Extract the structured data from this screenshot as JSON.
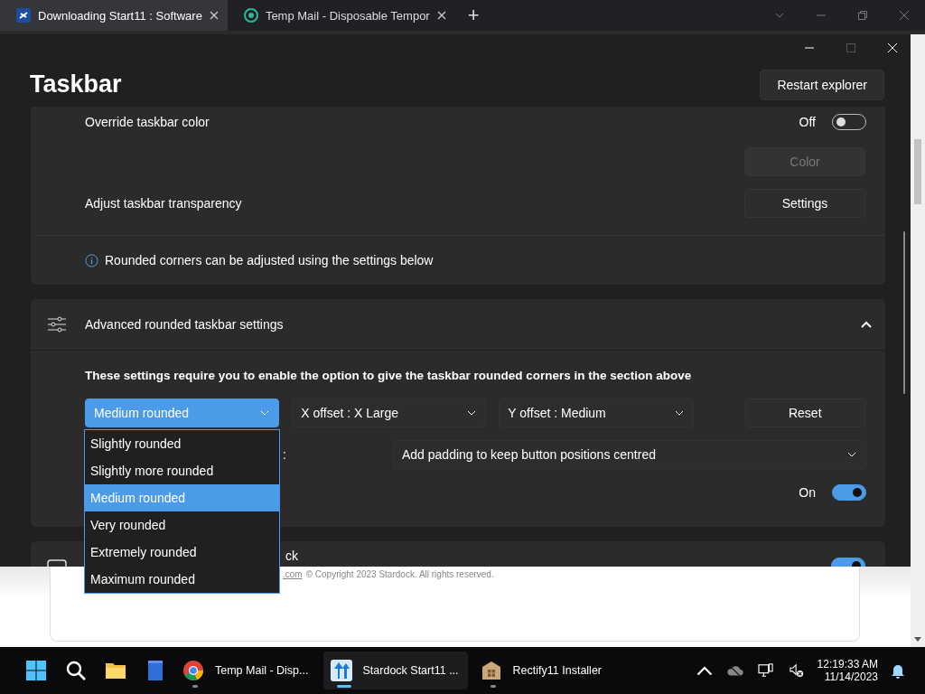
{
  "browser": {
    "tabs": [
      {
        "title": "Downloading Start11 : Software",
        "selected": true
      },
      {
        "title": "Temp Mail - Disposable Tempor",
        "selected": false
      }
    ],
    "new_tab": "+"
  },
  "window": {
    "title": "Taskbar",
    "restart_button": "Restart explorer"
  },
  "color_section": {
    "rows": [
      {
        "kind": "toggle",
        "label": "Override taskbar color",
        "state_text": "Off",
        "on": false
      },
      {
        "kind": "button",
        "button": "Color",
        "disabled": true
      },
      {
        "kind": "button",
        "label": "Adjust taskbar transparency",
        "button": "Settings",
        "disabled": false
      },
      {
        "kind": "info",
        "text": "Rounded corners can be adjusted using the settings below"
      }
    ]
  },
  "advanced": {
    "title": "Advanced rounded taskbar settings",
    "expanded": true,
    "note": "These settings require you to enable the option to give the taskbar rounded corners in the section above",
    "dropdowns": [
      {
        "value": "Medium rounded",
        "open": true
      },
      {
        "value": "X offset : X Large",
        "open": false
      },
      {
        "value": "Y offset : Medium",
        "open": false
      }
    ],
    "reset_button": "Reset",
    "padding_row": {
      "label": ":",
      "value": "Add padding to keep button positions centred"
    },
    "toggle_row": {
      "state_text": "On",
      "on": true
    },
    "menu": [
      {
        "label": "Slightly rounded",
        "selected": false
      },
      {
        "label": "Slightly more rounded",
        "selected": false
      },
      {
        "label": "Medium rounded",
        "selected": true
      },
      {
        "label": "Very rounded",
        "selected": false
      },
      {
        "label": "Extremely rounded",
        "selected": false
      },
      {
        "label": "Maximum rounded",
        "selected": false
      }
    ]
  },
  "next_section": {
    "label": "ck",
    "on": true
  },
  "page_footer": {
    "link": ".com",
    "text": "© Copyright 2023 Stardock. All rights reserved."
  },
  "taskbar": {
    "items": [
      {
        "kind": "start"
      },
      {
        "kind": "search"
      },
      {
        "kind": "folder"
      },
      {
        "kind": "notebook"
      },
      {
        "kind": "chrome",
        "label": "Temp Mail - Disp...",
        "running": true,
        "active": false
      },
      {
        "kind": "start11",
        "label": "Stardock Start11 ...",
        "running": true,
        "active": true
      },
      {
        "kind": "box",
        "label": "Rectify11 Installer",
        "running": true,
        "active": false
      }
    ],
    "clock": {
      "time": "12:19:33 AM",
      "date": "11/14/2023"
    }
  }
}
